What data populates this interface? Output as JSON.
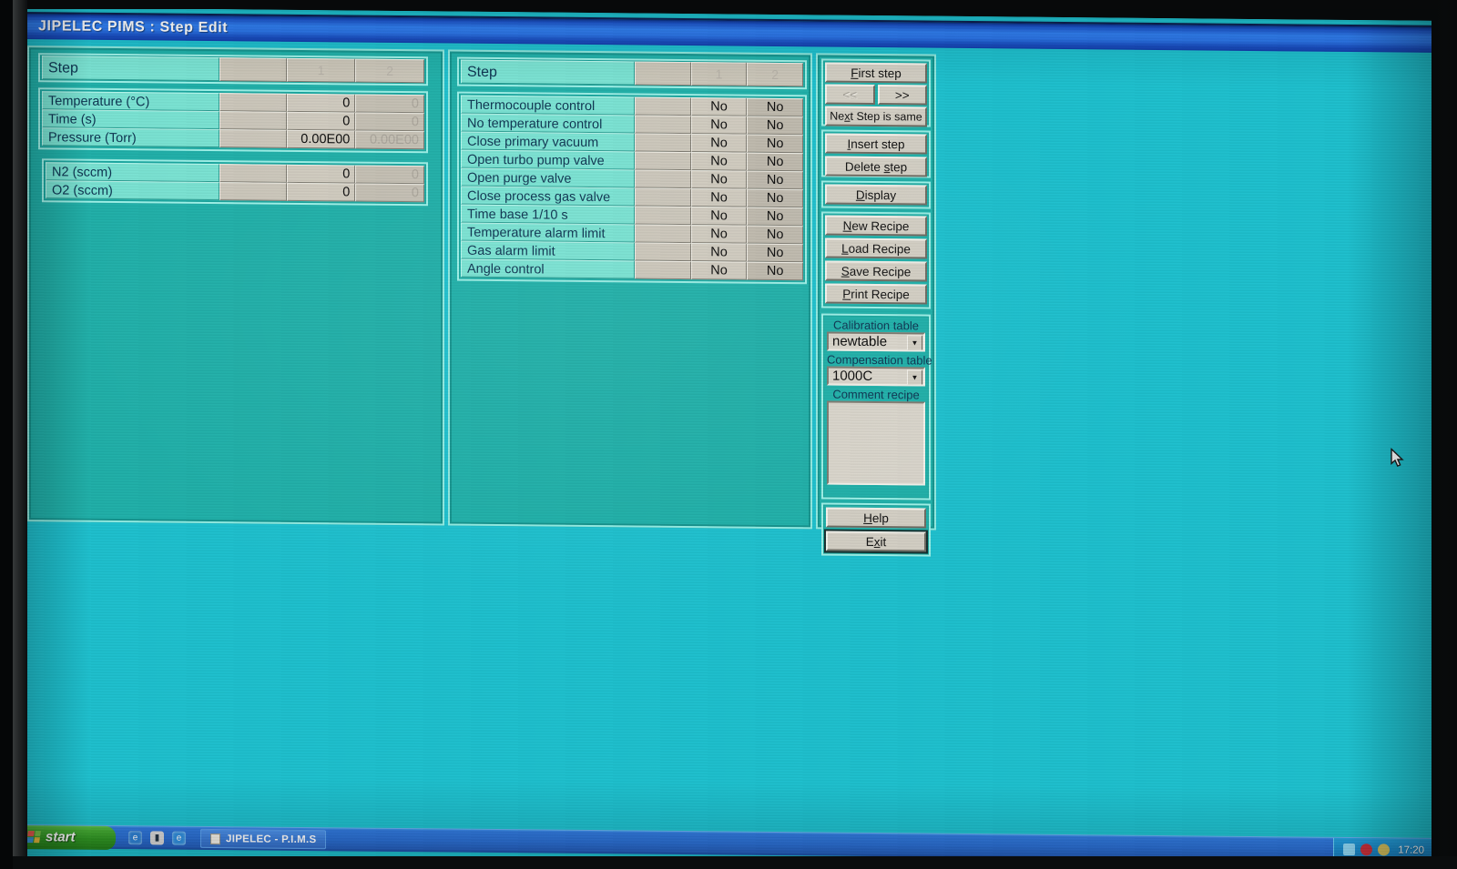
{
  "window": {
    "title": "JIPELEC  PIMS : Step Edit"
  },
  "left_panel": {
    "step_header": {
      "label": "Step",
      "col_blank": "",
      "col_1": "1",
      "col_2": "2"
    },
    "process_rows": [
      {
        "label": "Temperature (°C)",
        "col_blank": "",
        "col_1": "0",
        "col_2": "0"
      },
      {
        "label": "Time (s)",
        "col_blank": "",
        "col_1": "0",
        "col_2": "0"
      },
      {
        "label": "Pressure (Torr)",
        "col_blank": "",
        "col_1": "0.00E00",
        "col_2": "0.00E00"
      }
    ],
    "gas_rows": [
      {
        "label": "N2 (sccm)",
        "col_blank": "",
        "col_1": "0",
        "col_2": "0"
      },
      {
        "label": "O2 (sccm)",
        "col_blank": "",
        "col_1": "0",
        "col_2": "0"
      }
    ]
  },
  "mid_panel": {
    "step_header": {
      "label": "Step",
      "col_blank": "",
      "col_1": "1",
      "col_2": "2"
    },
    "option_rows": [
      {
        "label": "Thermocouple control",
        "col_blank": "",
        "col_1": "No",
        "col_2": "No"
      },
      {
        "label": "No temperature control",
        "col_blank": "",
        "col_1": "No",
        "col_2": "No"
      },
      {
        "label": "Close primary vacuum",
        "col_blank": "",
        "col_1": "No",
        "col_2": "No"
      },
      {
        "label": "Open turbo pump valve",
        "col_blank": "",
        "col_1": "No",
        "col_2": "No"
      },
      {
        "label": "Open purge valve",
        "col_blank": "",
        "col_1": "No",
        "col_2": "No"
      },
      {
        "label": "Close process gas valve",
        "col_blank": "",
        "col_1": "No",
        "col_2": "No"
      },
      {
        "label": "Time base 1/10 s",
        "col_blank": "",
        "col_1": "No",
        "col_2": "No"
      },
      {
        "label": "Temperature alarm limit",
        "col_blank": "",
        "col_1": "No",
        "col_2": "No"
      },
      {
        "label": "Gas alarm limit",
        "col_blank": "",
        "col_1": "No",
        "col_2": "No"
      },
      {
        "label": "Angle control",
        "col_blank": "",
        "col_1": "No",
        "col_2": "No"
      }
    ]
  },
  "right_panel": {
    "buttons": {
      "first_step": "First step",
      "prev": "<<",
      "next": ">>",
      "next_step_same": "Next Step is same",
      "insert_step": "Insert step",
      "delete_step": "Delete step",
      "display": "Display",
      "new_recipe": "New Recipe",
      "load_recipe": "Load Recipe",
      "save_recipe": "Save Recipe",
      "print_recipe": "Print Recipe",
      "help": "Help",
      "exit": "Exit"
    },
    "calibration_table": {
      "label": "Calibration table",
      "value": "newtable"
    },
    "compensation_table": {
      "label": "Compensation table",
      "value": "1000C"
    },
    "comment_recipe": {
      "label": "Comment recipe",
      "value": ""
    }
  },
  "taskbar": {
    "start_label": "start",
    "task_label": "JIPELEC - P.I.M.S",
    "clock": "17:20"
  },
  "colors": {
    "desktop": "#1dbfcd",
    "panel": "#1fafa8",
    "label_cell": "#79e2d2",
    "field": "#cfcabe",
    "titlebar_blue": "#2f7ff2",
    "text_navy": "#0c3350"
  }
}
